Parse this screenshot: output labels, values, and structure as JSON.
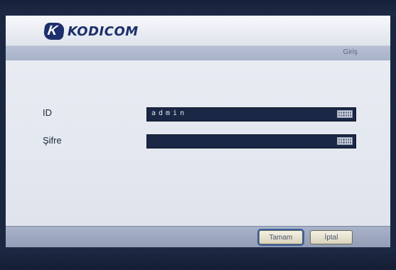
{
  "brand": {
    "logo_mark": "K",
    "logo_text": "KODICOM"
  },
  "dialog": {
    "title": "Giriş"
  },
  "form": {
    "id_label": "ID",
    "id_value": "admin",
    "password_label": "Şifre",
    "password_value": ""
  },
  "buttons": {
    "ok_label": "Tamam",
    "cancel_label": "İptal"
  },
  "icons": {
    "virtual_keyboard": "keyboard-icon"
  },
  "colors": {
    "background": "#1b2740",
    "field_background": "#1a2745",
    "brand": "#1d2f6b",
    "focus_outline": "#3a5f9f"
  }
}
